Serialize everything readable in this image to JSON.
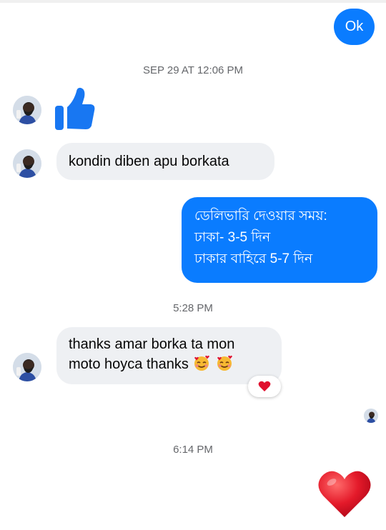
{
  "messages": [
    {
      "type": "outgoing",
      "text": "Ok"
    },
    {
      "type": "timestamp",
      "text": "SEP 29 AT 12:06 PM"
    },
    {
      "type": "incoming-sticker",
      "sticker": "thumbs-up-icon"
    },
    {
      "type": "incoming",
      "text": "kondin diben apu borkata"
    },
    {
      "type": "outgoing",
      "lines": [
        "ডেলিভারি দেওয়ার সময়:",
        "ঢাকা- 3-5 দিন",
        "ঢাকার বাহিরে 5-7 দিন"
      ]
    },
    {
      "type": "timestamp",
      "text": "5:28 PM"
    },
    {
      "type": "incoming",
      "lines": [
        "thanks amar borka ta mon",
        "moto hoyca thanks"
      ],
      "emojis": [
        "smiling-face-with-hearts-icon",
        "smiling-face-with-hearts-icon"
      ],
      "reaction": "red-heart-icon"
    },
    {
      "type": "timestamp",
      "text": "6:14 PM"
    },
    {
      "type": "outgoing-sticker",
      "sticker": "big-red-heart-icon"
    }
  ],
  "colors": {
    "outgoing_bubble": "#0a7cff",
    "incoming_bubble": "#eef0f3",
    "timestamp_text": "#65676b",
    "like_blue": "#1877f2",
    "heart_red": "#e0102e"
  }
}
